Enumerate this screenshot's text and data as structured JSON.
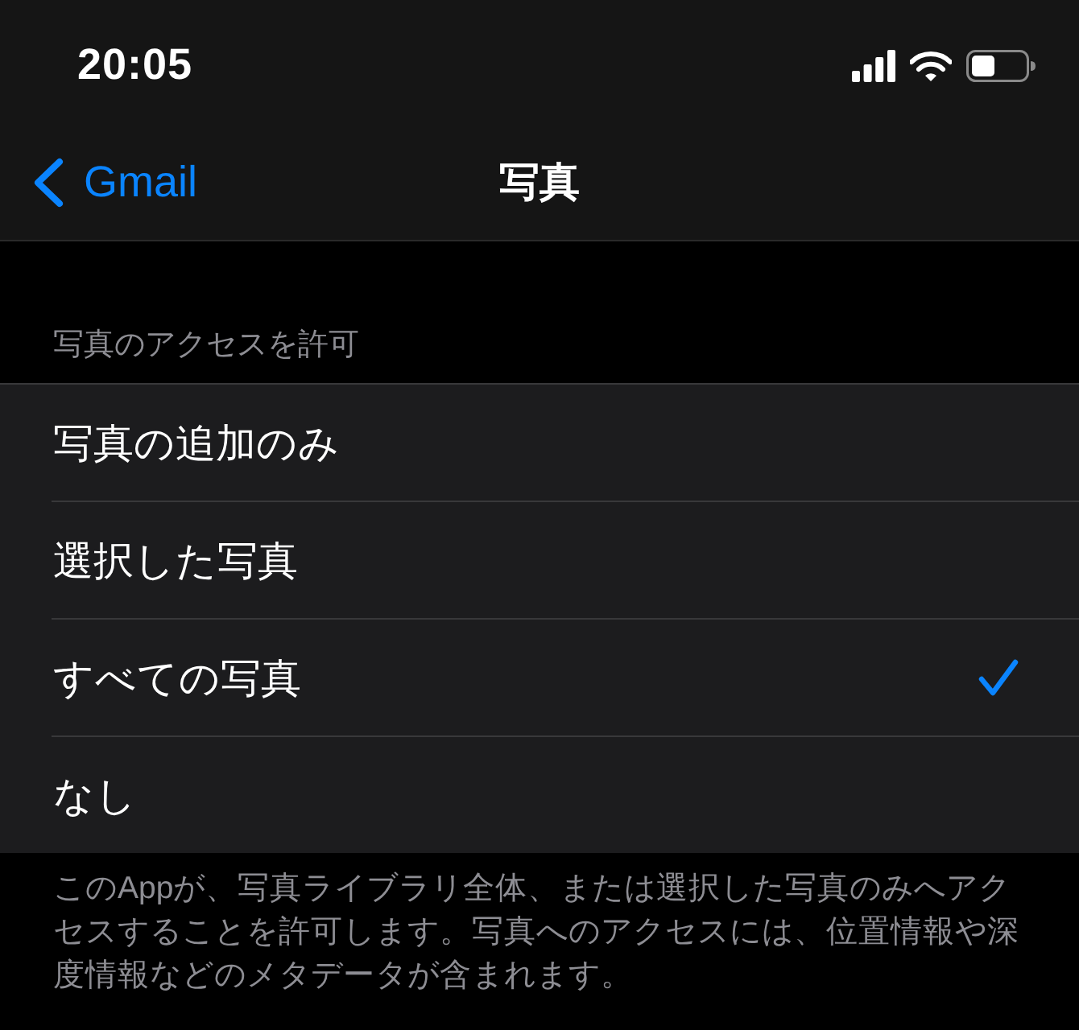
{
  "status_bar": {
    "time": "20:05"
  },
  "nav": {
    "back_label": "Gmail",
    "title": "写真"
  },
  "section": {
    "header": "写真のアクセスを許可",
    "options": [
      {
        "label": "写真の追加のみ",
        "selected": false
      },
      {
        "label": "選択した写真",
        "selected": false
      },
      {
        "label": "すべての写真",
        "selected": true
      },
      {
        "label": "なし",
        "selected": false
      }
    ],
    "footer": "このAppが、写真ライブラリ全体、または選択した写真のみへアクセスすることを許可します。写真へのアクセスには、位置情報や深度情報などのメタデータが含まれます。"
  }
}
